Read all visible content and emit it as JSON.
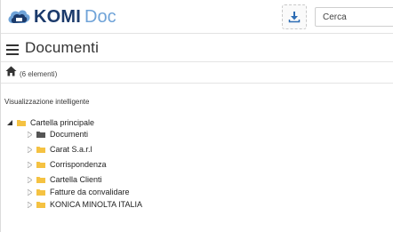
{
  "header": {
    "logo_bold": "KOMI",
    "logo_light": "Doc",
    "search_placeholder": "Cerca",
    "logo_icon": "cloud-icon",
    "download_icon": "download-icon"
  },
  "page": {
    "title": "Documenti",
    "element_count": "(6 elementi)"
  },
  "tree": {
    "section_label": "Visualizzazione intelligente",
    "root": {
      "label": "Cartella principale",
      "expanded": true
    },
    "children": [
      {
        "label": "Documenti",
        "icon": "folder-dark-icon"
      },
      {
        "label": "Carat S.a.r.l",
        "icon": "folder-icon"
      },
      {
        "label": "Corrispondenza",
        "icon": "folder-icon"
      },
      {
        "label": "Cartella Clienti",
        "icon": "folder-icon"
      },
      {
        "label": "Fatture da convalidare",
        "icon": "folder-icon"
      },
      {
        "label": "KONICA MINOLTA ITALIA",
        "icon": "folder-icon"
      }
    ]
  },
  "colors": {
    "brand_dark": "#1b3a6b",
    "brand_light": "#6fa3d8",
    "folder_yellow": "#f5c242",
    "folder_dark": "#555555"
  }
}
